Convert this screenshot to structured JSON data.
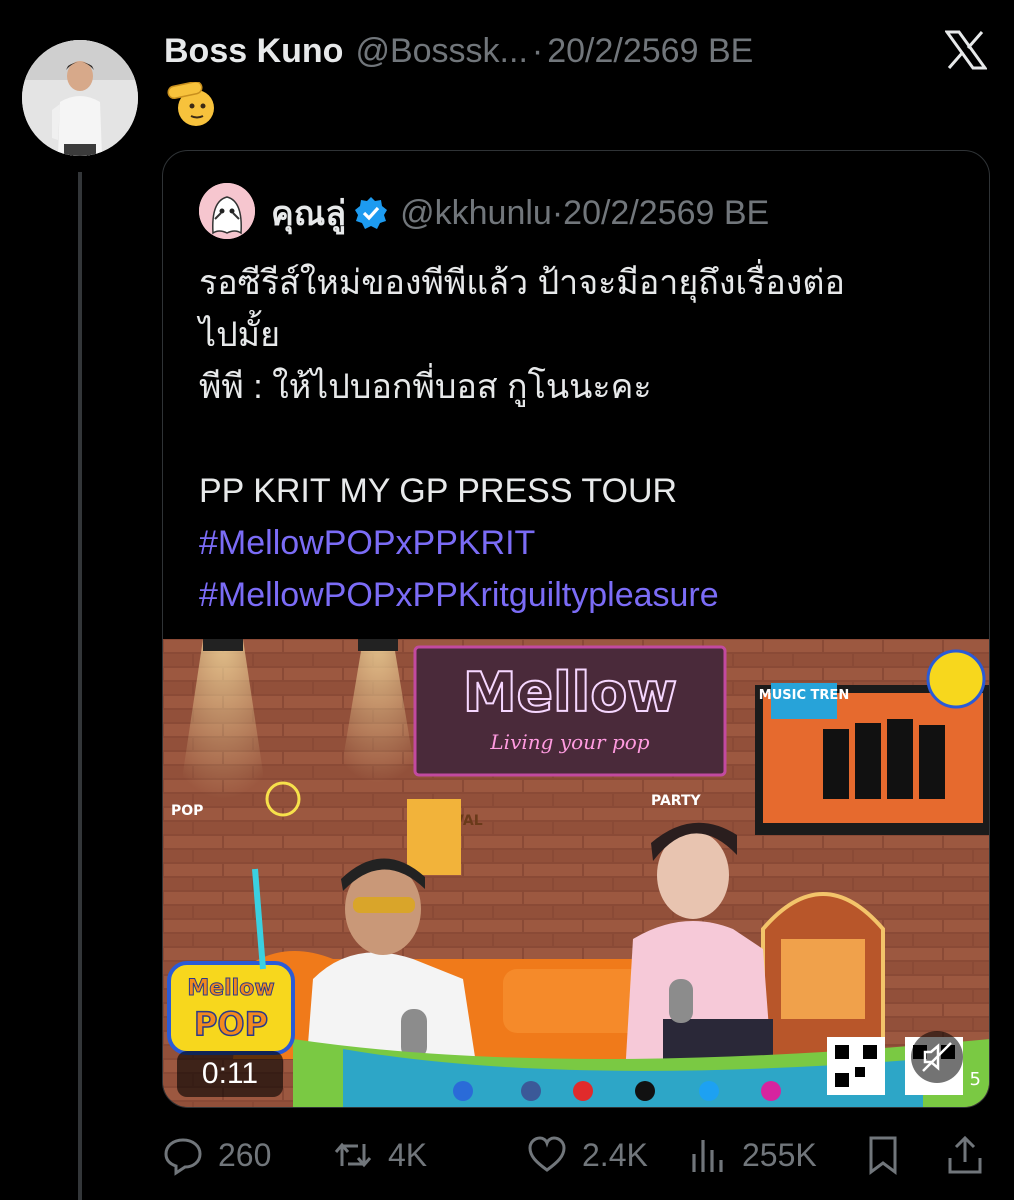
{
  "tweet": {
    "author_name": "Boss Kuno",
    "author_handle": "@Bosssk...",
    "separator": "·",
    "date": "20/2/2569 BE",
    "body_emoji": "🫡"
  },
  "quote": {
    "author_name": "คุณลู่",
    "author_handle": "@kkhunlu",
    "separator": "·",
    "date": "20/2/2569 BE",
    "lines": [
      "รอซีรีส์ใหม่ของพีพีแล้ว ป้าจะมีอายุถึงเรื่องต่อ",
      "ไปมั้ย",
      "พีพี : ให้ไปบอกพี่บอส กูโนนะคะ",
      "",
      "PP KRIT MY GP PRESS TOUR"
    ],
    "hashtags": [
      "#MellowPOPxPPKRIT",
      "#MellowPOPxPPKritguiltypleasure"
    ],
    "video": {
      "duration": "0:11",
      "neon_sign": "Mellow",
      "neon_sub": "Living your pop",
      "logo_top": "Mellow",
      "logo_bottom": "POP",
      "tv_label": "MUSIC TREN",
      "pop_tag": "POP",
      "party_tag": "PARTY",
      "festival_tag": "FESTIVAL",
      "viewer_count": "5"
    }
  },
  "actions": {
    "replies": "260",
    "reposts": "4K",
    "likes": "2.4K",
    "views": "255K"
  },
  "colors": {
    "background": "#000000",
    "hashtag": "#7b6cf6",
    "muted": "#71767b",
    "verified": "#1d9bf0"
  }
}
